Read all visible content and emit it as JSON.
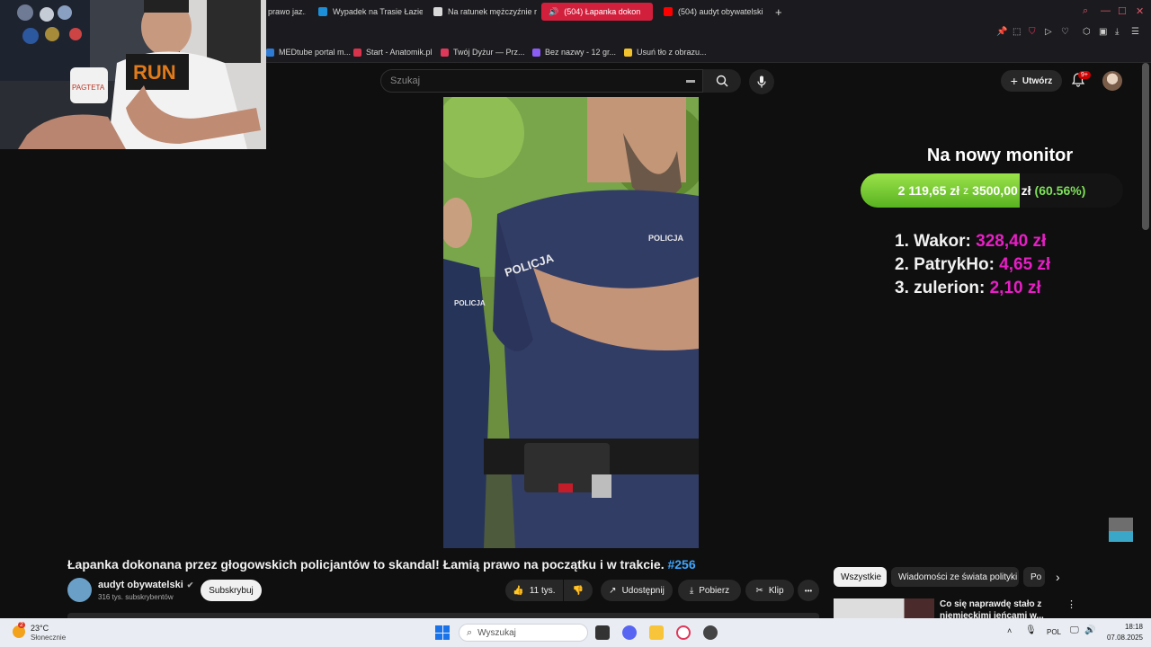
{
  "browser": {
    "tabs": [
      {
        "label": "prawo jaz...",
        "active": false,
        "fav_color": "#3a3a3a"
      },
      {
        "label": "Wypadek na Trasie Łazie",
        "active": false,
        "fav_color": "#1d8fd9"
      },
      {
        "label": "Na ratunek mężczyźnie r",
        "active": false,
        "fav_color": "#d8d8d8"
      },
      {
        "label": "(504) Łapanka dokon",
        "active": true,
        "fav_color": "#ff0000"
      },
      {
        "label": "(504) audyt obywatelski",
        "active": false,
        "fav_color": "#ff0000"
      }
    ],
    "bookmarks": [
      {
        "label": "MEDtube portal m...",
        "fav_color": "#2e7bd6"
      },
      {
        "label": "Start - Anatomik.pl",
        "fav_color": "#d9334c"
      },
      {
        "label": "Twój Dyżur — Prz...",
        "fav_color": "#e0385a"
      },
      {
        "label": "Bez nazwy - 12 gr...",
        "fav_color": "#8b5cf6"
      },
      {
        "label": "Usuń tło z obrazu...",
        "fav_color": "#f2c12e"
      }
    ]
  },
  "youtube": {
    "search_placeholder": "Szukaj",
    "create_label": "Utwórz",
    "notif_count": "9+",
    "video_title": "Łapanka dokonana przez głogowskich policjantów to skandal! Łamią prawo na początku i w trakcie.",
    "video_hashtag": "#256",
    "channel_name": "audyt obywatelski",
    "channel_subs": "316 tys. subskrybentów",
    "subscribe_label": "Subskrybuj",
    "like_count": "11 tys.",
    "share_label": "Udostępnij",
    "download_label": "Pobierz",
    "clip_label": "Klip",
    "more_label": "•••",
    "chips": [
      "Wszystkie",
      "Wiadomości ze świata polityki",
      "Po"
    ],
    "rec_title": "Co się naprawdę stało z niemieckimi jeńcami w..."
  },
  "overlay": {
    "goal_title": "Na nowy monitor",
    "goal_current": "2 119,65 zł",
    "goal_sep": "z",
    "goal_target": "3500,00 zł",
    "goal_percent": "(60.56%)",
    "goal_fraction": 0.6056,
    "donors": [
      {
        "rank": "1.",
        "name": "Wakor:",
        "amount": "328,40 zł"
      },
      {
        "rank": "2.",
        "name": "PatrykHo:",
        "amount": "4,65 zł"
      },
      {
        "rank": "3.",
        "name": "zulerion:",
        "amount": "2,10 zł"
      }
    ]
  },
  "taskbar": {
    "weather_temp": "23°C",
    "weather_desc": "Słonecznie",
    "weather_badge": "2",
    "search_placeholder": "Wyszukaj",
    "lang": "POL",
    "time": "18:18",
    "date": "07.08.2025"
  },
  "colors": {
    "accent_red": "#d21f3c",
    "goal_green": "#58b321",
    "donor_amount": "#e81ec6",
    "link_blue": "#3ea6ff"
  }
}
